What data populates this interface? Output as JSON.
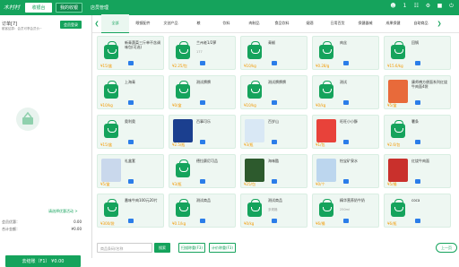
{
  "header": {
    "logo": "木村村",
    "btn_cashier": "收银台",
    "btn_orders": "我的收银",
    "btn_shift": "店员管理",
    "icons": [
      "user-icon",
      "cart-icon",
      "settings-icon",
      "lock-icon",
      "power-icon"
    ],
    "user_num": "1"
  },
  "order": {
    "title": "订单[7]",
    "subtitle": "散客结算：会员可享会员价~",
    "member_btn": "会员登录",
    "clear_link": "请选择优惠活动 >",
    "rows": [
      {
        "label": "会员优惠：",
        "value": "0.00"
      },
      {
        "label": "合计金额：",
        "value": "¥0.00"
      }
    ],
    "pay_label": "去结账（F1）",
    "pay_amount": "¥0.00"
  },
  "categories": [
    "全部",
    "眼镜配件",
    "文创产品",
    "粮",
    "饮料",
    "肉制品",
    "食品饮料",
    "烟酒",
    "日用百货",
    "保健器械",
    "成果保健",
    "自助商品"
  ],
  "active_category": "全部",
  "products": [
    {
      "name": "新青蔬菜三斤单不含调味包(可选)",
      "price": "¥15/盒",
      "stock": "",
      "img": "bag"
    },
    {
      "name": "兰州老1/2萝",
      "price": "¥2.25/包",
      "stock": "177",
      "img": "bag"
    },
    {
      "name": "青椒",
      "price": "¥10/kg",
      "stock": "",
      "img": "bag"
    },
    {
      "name": "肉丝",
      "price": "¥0.28/g",
      "stock": "",
      "img": "bag"
    },
    {
      "name": "回锅",
      "price": "¥15.6/kg",
      "stock": "",
      "img": "bag"
    },
    {
      "name": "上海青",
      "price": "¥10/kg",
      "stock": "",
      "img": "bag"
    },
    {
      "name": "测试牌牌",
      "price": "¥0/盒",
      "stock": "",
      "img": "bag"
    },
    {
      "name": "测试牌牌牌",
      "price": "¥10/kg",
      "stock": "",
      "img": "bag"
    },
    {
      "name": "测试",
      "price": "¥0/kg",
      "stock": "",
      "img": "bag"
    },
    {
      "name": "康师傅方便面系列红烧牛肉面4袋",
      "price": "¥5/盒",
      "stock": "",
      "img": "sausage"
    },
    {
      "name": "奥利奥",
      "price": "¥15/盒",
      "stock": "",
      "img": "bag"
    },
    {
      "name": "百事可乐",
      "price": "¥2.5/瓶",
      "stock": "",
      "img": "cola"
    },
    {
      "name": "百岁山",
      "price": "¥3/瓶",
      "stock": "",
      "img": "water"
    },
    {
      "name": "旺旺小小酥",
      "price": "¥1/包",
      "stock": "",
      "img": "snacks"
    },
    {
      "name": "薯条",
      "price": "¥2.6/包",
      "stock": "",
      "img": "bag"
    },
    {
      "name": "礼盒套",
      "price": "¥5/盒",
      "stock": "",
      "img": "pack"
    },
    {
      "name": "德拉赛尼可品",
      "price": "¥3/瓶",
      "stock": "",
      "img": "bag"
    },
    {
      "name": "海味酷",
      "price": "¥25/包",
      "stock": "",
      "img": "chips"
    },
    {
      "name": "怡宝矿泉水",
      "price": "¥0/个",
      "stock": "",
      "img": "bottles"
    },
    {
      "name": "红烧牛肉面",
      "price": "¥5/桶",
      "stock": "",
      "img": "noodle"
    },
    {
      "name": "番味牛肉100元20片",
      "price": "¥300/袋",
      "stock": "",
      "img": "bag"
    },
    {
      "name": "测试商品",
      "price": "¥0.1/kg",
      "stock": "",
      "img": "bag"
    },
    {
      "name": "测试商品",
      "price": "¥0/kg",
      "stock": "多规格",
      "img": "bag"
    },
    {
      "name": "精华营养奶牛奶",
      "price": "¥6/桶",
      "stock": "250ml",
      "img": "bag"
    },
    {
      "name": "coca",
      "price": "¥6/瓶",
      "stock": "",
      "img": "bag"
    }
  ],
  "bottom": {
    "search_placeholder": "商品条码/名称",
    "search_btn": "搜索",
    "btn_scale": "扫描称重(F3)",
    "btn_weigh": "计价称重(F3)",
    "btn_prev": "上一页"
  },
  "colors": {
    "brand": "#15a35c",
    "price": "#f29900"
  }
}
